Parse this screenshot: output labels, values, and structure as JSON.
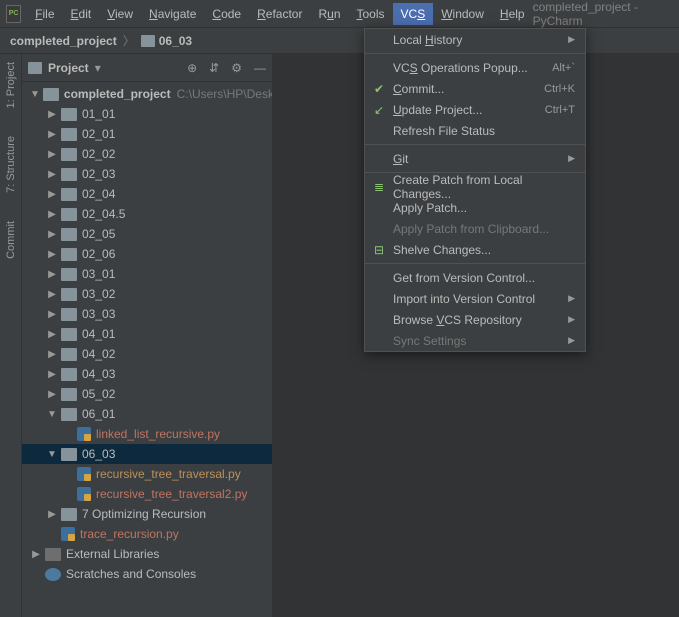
{
  "app": {
    "title": "completed_project - PyCharm",
    "logo": "PC"
  },
  "menubar": [
    {
      "label": "File",
      "u": "F"
    },
    {
      "label": "Edit",
      "u": "E"
    },
    {
      "label": "View",
      "u": "V"
    },
    {
      "label": "Navigate",
      "u": "N"
    },
    {
      "label": "Code",
      "u": "C"
    },
    {
      "label": "Refactor",
      "u": "R"
    },
    {
      "label": "Run",
      "u": "u",
      "pre": "R",
      "post": "n"
    },
    {
      "label": "Tools",
      "u": "T"
    },
    {
      "label": "VCS",
      "u": "S",
      "pre": "VC",
      "active": true
    },
    {
      "label": "Window",
      "u": "W"
    },
    {
      "label": "Help",
      "u": "H"
    }
  ],
  "breadcrumb": {
    "root": "completed_project",
    "current": "06_03"
  },
  "sidebars": [
    {
      "label": "1: Project"
    },
    {
      "label": "7: Structure"
    },
    {
      "label": "Commit"
    }
  ],
  "project_panel": {
    "title": "Project",
    "tools": {
      "target": "⊕",
      "collapse": "⇵",
      "settings": "⚙",
      "hide": "—"
    }
  },
  "tree": [
    {
      "depth": 1,
      "arrow": "open",
      "icon": "folder",
      "label": "completed_project",
      "rootPath": "C:\\Users\\HP\\Desktop",
      "style": "root"
    },
    {
      "depth": 2,
      "arrow": "closed",
      "icon": "folder",
      "label": "01_01"
    },
    {
      "depth": 2,
      "arrow": "closed",
      "icon": "folder",
      "label": "02_01"
    },
    {
      "depth": 2,
      "arrow": "closed",
      "icon": "folder",
      "label": "02_02"
    },
    {
      "depth": 2,
      "arrow": "closed",
      "icon": "folder",
      "label": "02_03"
    },
    {
      "depth": 2,
      "arrow": "closed",
      "icon": "folder",
      "label": "02_04"
    },
    {
      "depth": 2,
      "arrow": "closed",
      "icon": "folder",
      "label": "02_04.5"
    },
    {
      "depth": 2,
      "arrow": "closed",
      "icon": "folder",
      "label": "02_05"
    },
    {
      "depth": 2,
      "arrow": "closed",
      "icon": "folder",
      "label": "02_06"
    },
    {
      "depth": 2,
      "arrow": "closed",
      "icon": "folder",
      "label": "03_01"
    },
    {
      "depth": 2,
      "arrow": "closed",
      "icon": "folder",
      "label": "03_02"
    },
    {
      "depth": 2,
      "arrow": "closed",
      "icon": "folder",
      "label": "03_03"
    },
    {
      "depth": 2,
      "arrow": "closed",
      "icon": "folder",
      "label": "04_01"
    },
    {
      "depth": 2,
      "arrow": "closed",
      "icon": "folder",
      "label": "04_02"
    },
    {
      "depth": 2,
      "arrow": "closed",
      "icon": "folder",
      "label": "04_03"
    },
    {
      "depth": 2,
      "arrow": "closed",
      "icon": "folder",
      "label": "05_02"
    },
    {
      "depth": 2,
      "arrow": "open",
      "icon": "folder",
      "label": "06_01"
    },
    {
      "depth": 3,
      "arrow": "none",
      "icon": "py",
      "label": "linked_list_recursive.py",
      "style": "vcs-unversioned"
    },
    {
      "depth": 2,
      "arrow": "open",
      "icon": "folder",
      "label": "06_03",
      "selected": true
    },
    {
      "depth": 3,
      "arrow": "none",
      "icon": "py",
      "label": "recursive_tree_traversal.py",
      "style": "vcs-unknown"
    },
    {
      "depth": 3,
      "arrow": "none",
      "icon": "py",
      "label": "recursive_tree_traversal2.py",
      "style": "vcs-unversioned"
    },
    {
      "depth": 2,
      "arrow": "closed",
      "icon": "folder",
      "label": "7 Optimizing Recursion"
    },
    {
      "depth": 2,
      "arrow": "none",
      "icon": "py",
      "label": "trace_recursion.py",
      "style": "vcs-unversioned"
    },
    {
      "depth": 1,
      "arrow": "closed",
      "icon": "lib",
      "label": "External Libraries"
    },
    {
      "depth": 1,
      "arrow": "none",
      "icon": "scratch",
      "label": "Scratches and Consoles"
    }
  ],
  "dropdown": [
    {
      "type": "item",
      "label": "Local History",
      "u": "H",
      "pre": "Local ",
      "post": "istory",
      "submenu": true
    },
    {
      "type": "sep"
    },
    {
      "type": "item",
      "label": "VCS Operations Popup...",
      "u": "S",
      "pre": "VC",
      "post": " Operations Popup...",
      "shortcut": "Alt+`"
    },
    {
      "type": "item",
      "label": "Commit...",
      "u": "C",
      "post": "ommit...",
      "shortcut": "Ctrl+K",
      "icon": "✔"
    },
    {
      "type": "item",
      "label": "Update Project...",
      "u": "U",
      "post": "pdate Project...",
      "shortcut": "Ctrl+T",
      "icon": "↙"
    },
    {
      "type": "item",
      "label": "Refresh File Status"
    },
    {
      "type": "sep"
    },
    {
      "type": "item",
      "label": "Git",
      "u": "G",
      "post": "it",
      "submenu": true
    },
    {
      "type": "sep"
    },
    {
      "type": "item",
      "label": "Create Patch from Local Changes...",
      "icon": "≣"
    },
    {
      "type": "item",
      "label": "Apply Patch..."
    },
    {
      "type": "item",
      "label": "Apply Patch from Clipboard...",
      "disabled": true
    },
    {
      "type": "item",
      "label": "Shelve Changes...",
      "icon": "⊟"
    },
    {
      "type": "sep"
    },
    {
      "type": "item",
      "label": "Get from Version Control..."
    },
    {
      "type": "item",
      "label": "Import into Version Control",
      "submenu": true
    },
    {
      "type": "item",
      "label": "Browse VCS Repository",
      "u": "V",
      "pre": "Browse ",
      "post": "CS Repository",
      "submenu": true
    },
    {
      "type": "item",
      "label": "Sync Settings",
      "submenu": true,
      "disabled": true
    }
  ]
}
